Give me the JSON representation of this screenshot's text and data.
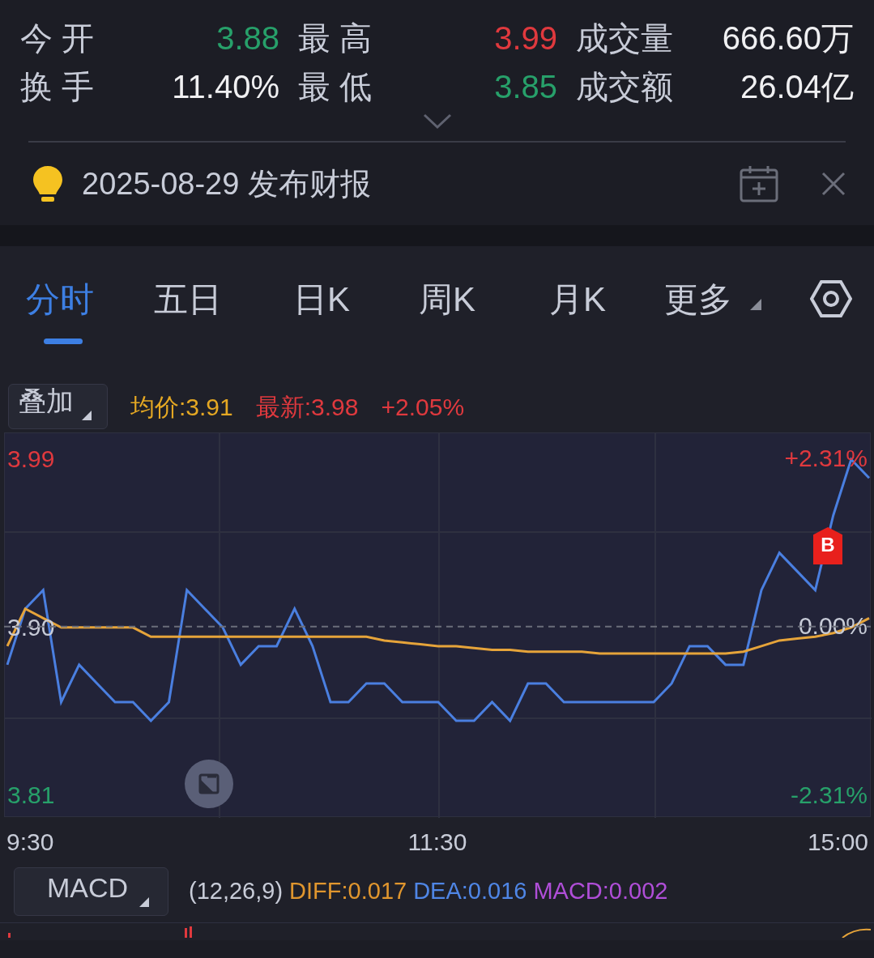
{
  "quote_stats": [
    {
      "label": "今 开",
      "value": "3.88",
      "color": "#27a06a"
    },
    {
      "label": "最 高",
      "value": "3.99",
      "color": "#e0393e"
    },
    {
      "label": "成交量",
      "value": "666.60万",
      "color": "#f0f0f2"
    },
    {
      "label": "换 手",
      "value": "11.40%",
      "color": "#f0f0f2"
    },
    {
      "label": "最 低",
      "value": "3.85",
      "color": "#27a06a"
    },
    {
      "label": "成交额",
      "value": "26.04亿",
      "color": "#f0f0f2"
    }
  ],
  "notice": {
    "text": "2025-08-29 发布财报"
  },
  "tabs": [
    {
      "label": "分时",
      "selected": true,
      "dropdown": false
    },
    {
      "label": "五日",
      "selected": false,
      "dropdown": false
    },
    {
      "label": "日K",
      "selected": false,
      "dropdown": false
    },
    {
      "label": "周K",
      "selected": false,
      "dropdown": false
    },
    {
      "label": "月K",
      "selected": false,
      "dropdown": false
    },
    {
      "label": "更多",
      "selected": false,
      "dropdown": true
    }
  ],
  "overlay_button": "叠加",
  "legend": [
    {
      "text": "均价:3.91",
      "color": "#e5a823"
    },
    {
      "text": "最新:3.98",
      "color": "#e0393e"
    },
    {
      "text": "+2.05%",
      "color": "#e0393e"
    }
  ],
  "percent_labels": [
    {
      "text": "+2.31%",
      "color": "#e0393e"
    },
    {
      "text": "0.00%",
      "color": "#c8ccd8"
    },
    {
      "text": "-2.31%",
      "color": "#27a06a"
    }
  ],
  "trade_marker": {
    "label": "B"
  },
  "time_labels": [
    "9:30",
    "11:30",
    "15:00"
  ],
  "chart_data": {
    "type": "line",
    "ylim": [
      3.798,
      4.004
    ],
    "grid": true,
    "yticks": [
      {
        "value": 3.81,
        "label": "3.81"
      },
      {
        "value": 3.9,
        "label": "3.90"
      },
      {
        "value": 3.99,
        "label": "3.99"
      }
    ],
    "series": [
      {
        "color": "#4a7fe0",
        "values": [
          3.88,
          3.91,
          3.92,
          3.86,
          3.88,
          3.87,
          3.86,
          3.86,
          3.85,
          3.86,
          3.92,
          3.91,
          3.9,
          3.88,
          3.89,
          3.89,
          3.91,
          3.89,
          3.86,
          3.86,
          3.87,
          3.87,
          3.86,
          3.86,
          3.86,
          3.85,
          3.85,
          3.86,
          3.85,
          3.87,
          3.87,
          3.86,
          3.86,
          3.86,
          3.86,
          3.86,
          3.86,
          3.87,
          3.89,
          3.89,
          3.88,
          3.88,
          3.92,
          3.94,
          3.93,
          3.92,
          3.96,
          3.99,
          3.98
        ]
      },
      {
        "color": "#e6a43a",
        "values": [
          3.89,
          3.91,
          3.905,
          3.9,
          3.9,
          3.9,
          3.9,
          3.9,
          3.895,
          3.895,
          3.895,
          3.895,
          3.895,
          3.895,
          3.895,
          3.895,
          3.895,
          3.895,
          3.895,
          3.895,
          3.895,
          3.893,
          3.892,
          3.891,
          3.89,
          3.89,
          3.889,
          3.888,
          3.888,
          3.887,
          3.887,
          3.887,
          3.887,
          3.886,
          3.886,
          3.886,
          3.886,
          3.886,
          3.886,
          3.886,
          3.886,
          3.887,
          3.89,
          3.893,
          3.894,
          3.895,
          3.897,
          3.9,
          3.905
        ]
      }
    ]
  },
  "indicator": {
    "button": "MACD",
    "params": "(12,26,9)",
    "values": [
      {
        "text": "DIFF:0.017",
        "color": "#e0962e"
      },
      {
        "text": "DEA:0.016",
        "color": "#4f86e6"
      },
      {
        "text": "MACD:0.002",
        "color": "#b04ed8"
      }
    ]
  }
}
